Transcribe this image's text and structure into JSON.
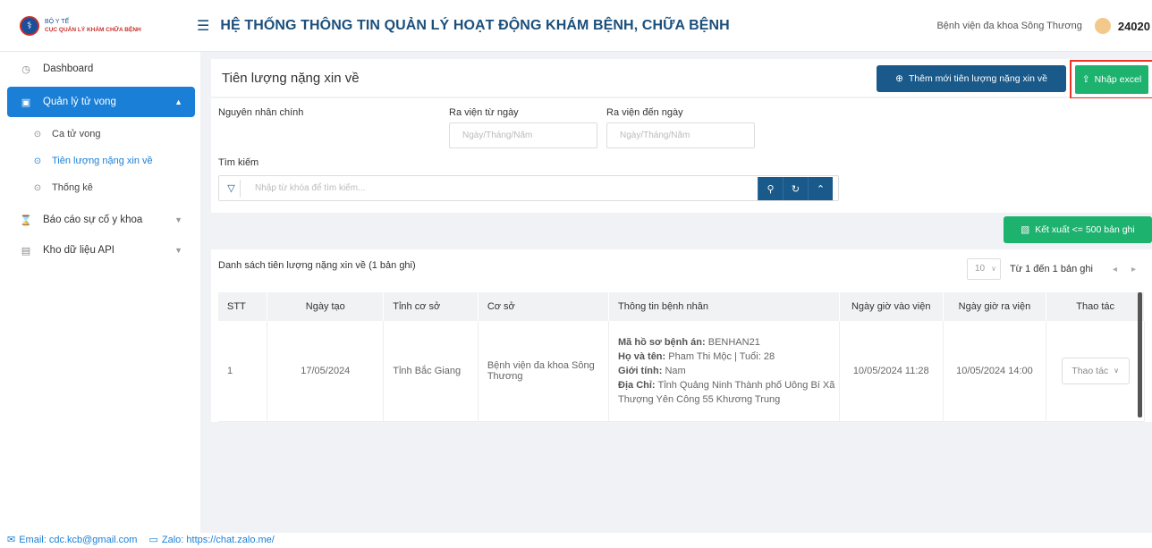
{
  "header": {
    "logo_line1": "BỘ Y TẾ",
    "logo_line2": "CỤC QUẢN LÝ KHÁM CHỮA BỆNH",
    "title": "HỆ THỐNG THÔNG TIN QUẢN LÝ HOẠT ĐỘNG KHÁM BỆNH, CHỮA BỆNH",
    "hospital": "Bệnh viện đa khoa Sông Thương",
    "user_code": "24020"
  },
  "sidebar": {
    "items": [
      {
        "label": "Dashboard",
        "icon": "clock-icon"
      },
      {
        "label": "Quản lý tử vong",
        "icon": "calendar-icon",
        "active": true
      },
      {
        "label": "Ca tử vong",
        "icon": "check-circle-icon"
      },
      {
        "label": "Tiên lượng nặng xin về",
        "icon": "check-circle-icon",
        "active": true
      },
      {
        "label": "Thống kê",
        "icon": "check-circle-icon"
      },
      {
        "label": "Báo cáo sự cố y khoa",
        "icon": "hourglass-icon"
      },
      {
        "label": "Kho dữ liệu API",
        "icon": "database-icon"
      }
    ]
  },
  "page": {
    "title": "Tiên lượng nặng xin về",
    "add_button": "Thêm mới tiên lượng nặng xin về",
    "import_button": "Nhập excel",
    "export_button": "Kết xuất <= 500 bản ghi"
  },
  "filters": {
    "cause_label": "Nguyên nhân chính",
    "from_label": "Ra viện từ ngày",
    "from_placeholder": "Ngày/Tháng/Năm",
    "to_label": "Ra viện đến ngày",
    "to_placeholder": "Ngày/Tháng/Năm",
    "search_label": "Tìm kiếm",
    "search_placeholder": "Nhập từ khóa để tìm kiếm..."
  },
  "list": {
    "title": "Danh sách tiên lượng nặng xin về (1 bản ghi)",
    "page_size": "10",
    "range_info": "Từ 1 đến 1 bản ghi",
    "columns": [
      "STT",
      "Ngày tạo",
      "Tỉnh cơ sở",
      "Cơ sở",
      "Thông tin bệnh nhân",
      "Ngày giờ vào viện",
      "Ngày giờ ra viện",
      "Thao tác"
    ],
    "rows": [
      {
        "stt": "1",
        "created": "17/05/2024",
        "province": "Tỉnh Bắc Giang",
        "facility": "Bệnh viện đa khoa Sông Thương",
        "record_label": "Mã hồ sơ bệnh án:",
        "record_value": "BENHAN21",
        "name_label": "Họ và tên:",
        "name_value": "Pham Thi Mộc | Tuổi: 28",
        "gender_label": "Giới tính:",
        "gender_value": "Nam",
        "address_label": "Địa Chỉ:",
        "address_value": "Tỉnh Quảng Ninh Thành phố Uông Bí Xã Thượng Yên Công 55 Khương Trung",
        "admit": "10/05/2024 11:28",
        "discharge": "10/05/2024 14:00",
        "action": "Thao tác"
      }
    ]
  },
  "footer": {
    "email": "Email: cdc.kcb@gmail.com",
    "zalo": "Zalo: https://chat.zalo.me/"
  }
}
